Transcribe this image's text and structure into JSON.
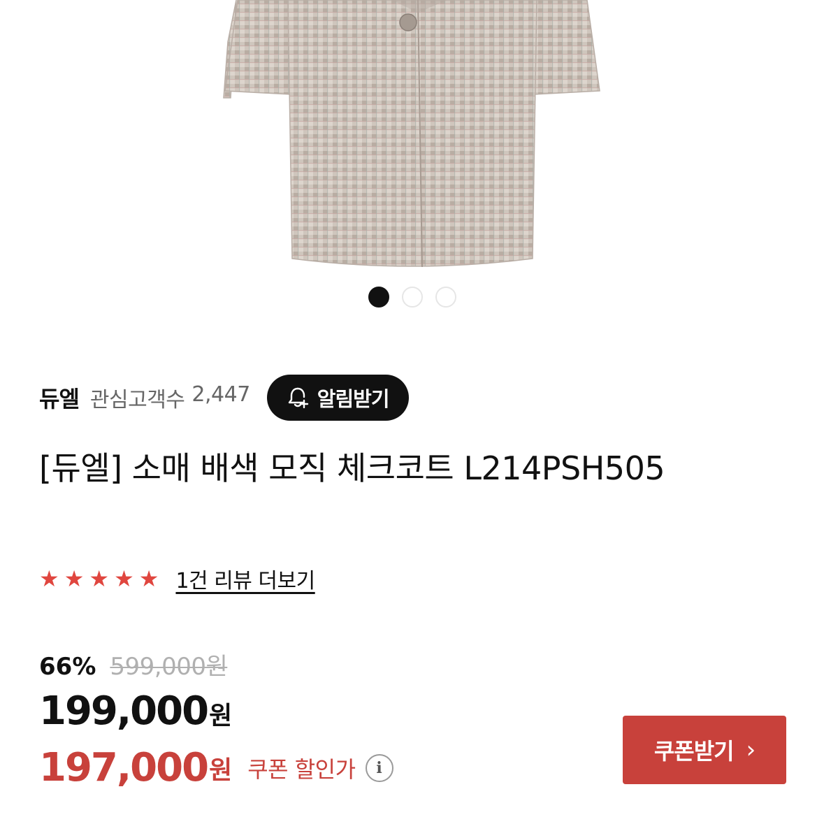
{
  "product_image": {
    "alt_icon": "product-image"
  },
  "carousel": {
    "count": 3,
    "active_index": 0
  },
  "brand": {
    "name": "듀엘",
    "follower_label": "관심고객수",
    "follower_count": "2,447",
    "notify_label": "알림받기"
  },
  "product": {
    "title": "[듀엘] 소매 배색 모직 체크코트 L214PSH505"
  },
  "rating": {
    "stars": 5,
    "review_link": "1건 리뷰 더보기"
  },
  "price": {
    "discount_rate": "66%",
    "original": "599,000원",
    "sale": "199,000",
    "sale_unit": "원",
    "coupon_price": "197,000",
    "coupon_unit": "원",
    "coupon_label": "쿠폰 할인가",
    "coupon_button": "쿠폰받기"
  },
  "colors": {
    "accent_red": "#c8413b",
    "star_red": "#e0463f",
    "dark": "#111111"
  }
}
